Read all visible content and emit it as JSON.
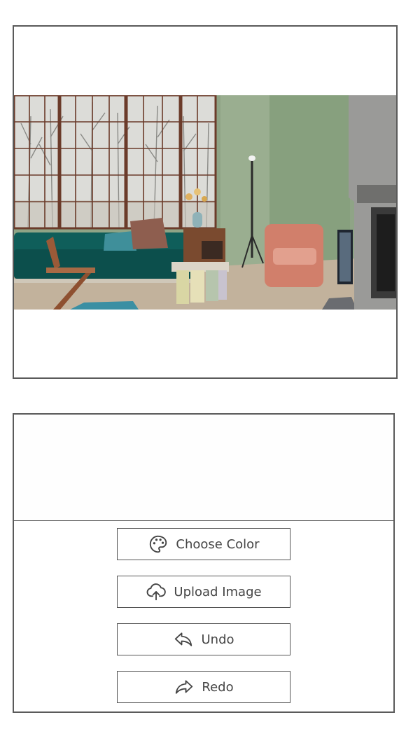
{
  "buttons": {
    "choose_color": {
      "label": "Choose Color",
      "icon": "palette-icon"
    },
    "upload_image": {
      "label": "Upload Image",
      "icon": "cloud-upload-icon"
    },
    "undo": {
      "label": "Undo",
      "icon": "undo-arrow-icon"
    },
    "redo": {
      "label": "Redo",
      "icon": "redo-arrow-icon"
    }
  },
  "colors": {
    "wall": "#8ea384",
    "sofa": "#0f5e5a",
    "armchair": "#d17f6b",
    "window_frame": "#6b3b2a",
    "floor": "#c7b8a3",
    "fireplace": "#9a9a98",
    "border": "#5a5a5a",
    "button_text": "#444444"
  }
}
